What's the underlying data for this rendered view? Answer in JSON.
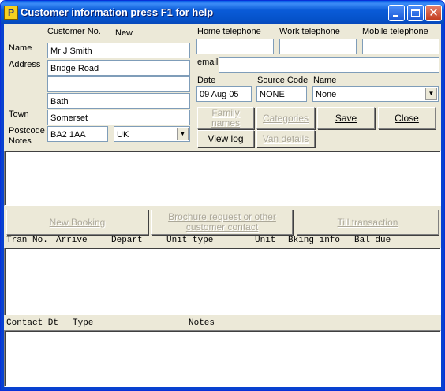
{
  "window": {
    "title": "Customer information press F1 for help",
    "icon_letter": "P",
    "controls": [
      "minimize-icon",
      "maximize-icon",
      "close-icon"
    ]
  },
  "customer": {
    "number_label": "Customer No.",
    "number_value": "New",
    "name_label": "Name",
    "name_value": "Mr J Smith",
    "address_label": "Address",
    "address_line1": "Bridge Road",
    "address_line2": "",
    "address_line3": "Bath",
    "town_label": "Town",
    "town_value": "Somerset",
    "postcode_label": "Postcode",
    "postcode_value": "BA2 1AA",
    "country_value": "UK",
    "notes_label": "Notes"
  },
  "contact": {
    "home_label": "Home telephone",
    "home_value": "",
    "work_label": "Work telephone",
    "work_value": "",
    "mobile_label": "Mobile telephone",
    "mobile_value": "",
    "email_label": "email",
    "email_value": ""
  },
  "meta": {
    "date_label": "Date",
    "date_value": "09 Aug 05",
    "source_label": "Source Code",
    "source_value": "NONE",
    "name_label": "Name",
    "name_value": "None"
  },
  "buttons": {
    "family_names": "Family names",
    "categories": "Categories",
    "save": "Save",
    "close": "Close",
    "view_log": "View log",
    "van_details": "Van details",
    "new_booking": "New Booking",
    "brochure": "Brochure request or other customer contact",
    "till": "Till transaction"
  },
  "bookings_table": {
    "columns": [
      "Tran No.",
      "Arrive",
      "Depart",
      "Unit type",
      "Unit",
      "Bking info",
      "Bal due"
    ],
    "rows": []
  },
  "contacts_table": {
    "columns": [
      "Contact Dt",
      "Type",
      "Notes"
    ],
    "rows": []
  }
}
